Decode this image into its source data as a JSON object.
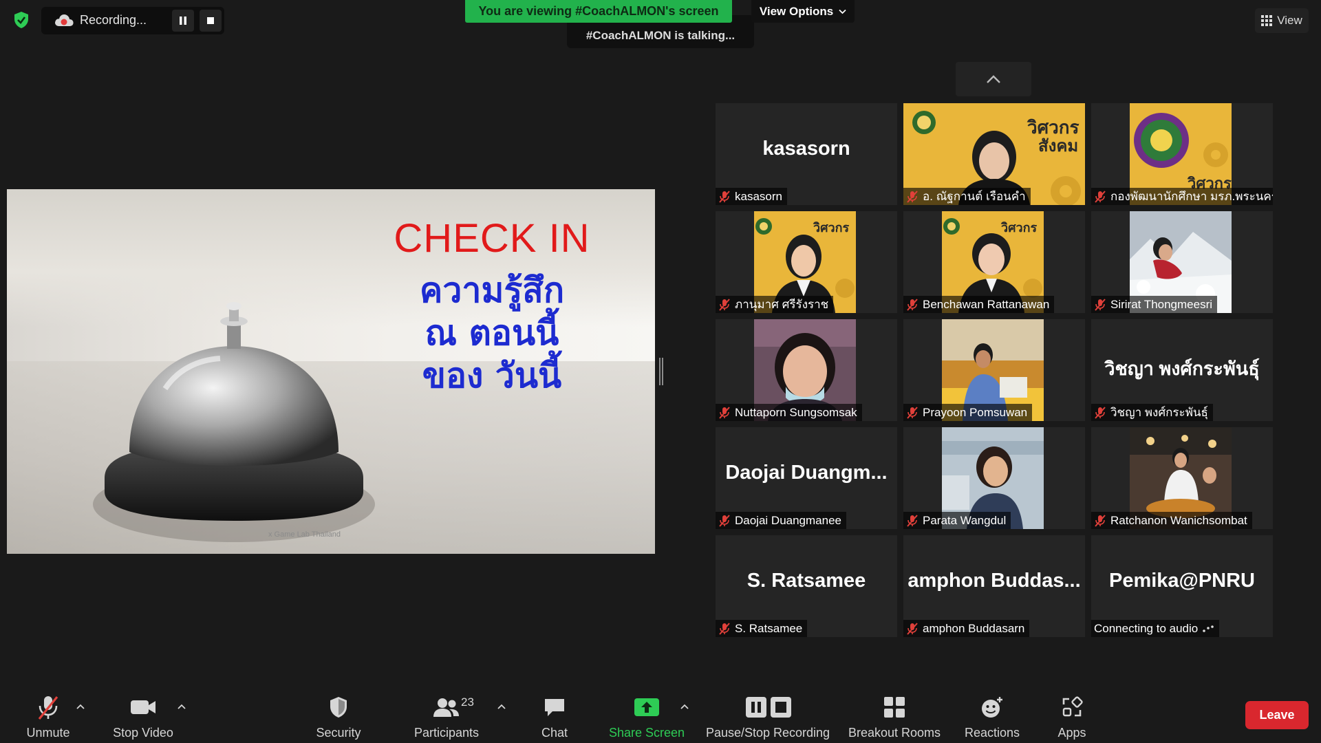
{
  "top_bar": {
    "recording_label": "Recording...",
    "viewing_banner": "You are viewing #CoachALMON's screen",
    "view_options_label": "View Options",
    "talking_label": "#CoachALMON is talking...",
    "view_button_label": "View"
  },
  "shared_screen": {
    "title": "CHECK IN",
    "lines": [
      "ความรู้สึก",
      "ณ ตอนนี้",
      "ของ วันนี้"
    ],
    "footer": "x Game Lab Thailand"
  },
  "participants": [
    {
      "display": "kasasorn",
      "name": "kasasorn",
      "muted": true
    },
    {
      "display": "",
      "name": "อ. ณัฐกานต์ เรือนคำ",
      "muted": true
    },
    {
      "display": "",
      "name": "กองพัฒนานักศึกษา มรภ.พระนคร",
      "muted": true
    },
    {
      "display": "",
      "name": "ภานุมาศ ศรีรังราช",
      "muted": true
    },
    {
      "display": "",
      "name": "Benchawan Rattanawan",
      "muted": true
    },
    {
      "display": "",
      "name": "Sirirat Thongmeesri",
      "muted": true
    },
    {
      "display": "",
      "name": "Nuttaporn Sungsomsak",
      "muted": true
    },
    {
      "display": "",
      "name": "Prayoon Pomsuwan",
      "muted": true
    },
    {
      "display": "วิชญา พงศ์กระพันธุ์",
      "name": "วิชญา พงศ์กระพันธุ์",
      "muted": true
    },
    {
      "display": "Daojai Duangm...",
      "name": "Daojai Duangmanee",
      "muted": true
    },
    {
      "display": "",
      "name": "Parata Wangdul",
      "muted": true
    },
    {
      "display": "",
      "name": "Ratchanon Wanichsombat",
      "muted": true
    },
    {
      "display": "S. Ratsamee",
      "name": "S. Ratsamee",
      "muted": true
    },
    {
      "display": "amphon Buddas...",
      "name": "amphon Buddasarn",
      "muted": true
    },
    {
      "display": "Pemika@PNRU",
      "name": "Connecting to audio",
      "muted": false
    }
  ],
  "toolbar": {
    "unmute": "Unmute",
    "stop_video": "Stop Video",
    "security": "Security",
    "participants": "Participants",
    "participants_count": "23",
    "chat": "Chat",
    "share_screen": "Share Screen",
    "pause_stop_recording": "Pause/Stop Recording",
    "breakout_rooms": "Breakout Rooms",
    "reactions": "Reactions",
    "apps": "Apps",
    "leave": "Leave"
  },
  "colors": {
    "background": "#1a1a1a",
    "banner_green": "#22b24c",
    "share_green": "#2ecc55",
    "leave_red": "#d9272e",
    "muted_red": "#e0403a",
    "slide_red": "#e11a1a",
    "slide_blue": "#1d2bd0"
  }
}
